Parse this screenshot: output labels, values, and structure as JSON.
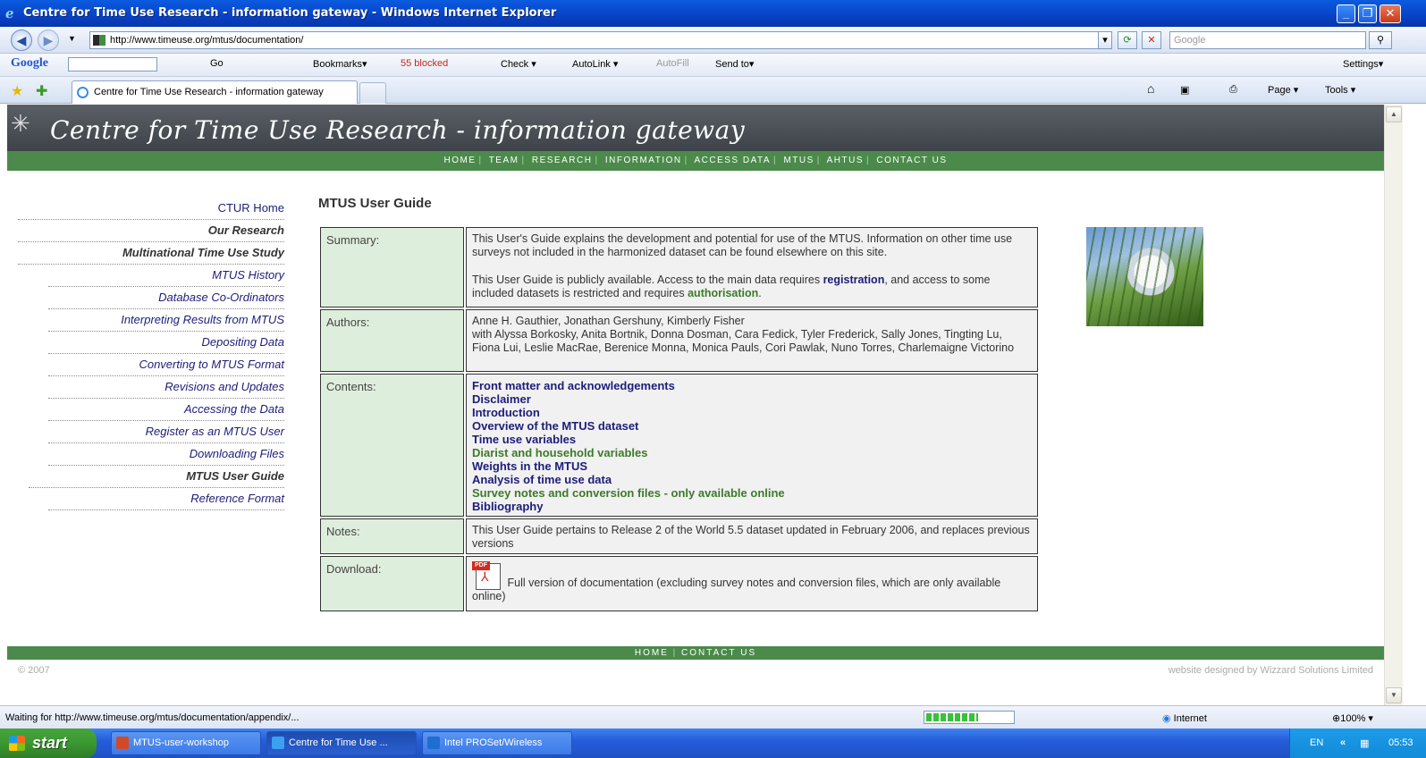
{
  "window": {
    "title": "Centre for Time Use Research - information gateway - Windows Internet Explorer",
    "buttons": [
      "_",
      "❐",
      "✕"
    ]
  },
  "address_bar": {
    "url": "http://www.timeuse.org/mtus/documentation/",
    "search_placeholder": "Google"
  },
  "google_toolbar": {
    "logo": "Google",
    "go": "Go",
    "bookmarks": "Bookmarks▾",
    "blocked": "55 blocked",
    "check": "Check ▾",
    "autolink": "AutoLink ▾",
    "autofill": "AutoFill",
    "sendto": "Send to▾",
    "settings": "Settings▾"
  },
  "tabs": {
    "active_tab": "Centre for Time Use Research - information gateway",
    "commands": {
      "page": "Page ▾",
      "tools": "Tools ▾"
    }
  },
  "site": {
    "title": "Centre for Time Use Research - information gateway",
    "nav": [
      "HOME",
      "TEAM",
      "RESEARCH",
      "INFORMATION",
      "ACCESS DATA",
      "MTUS",
      "AHTUS",
      "CONTACT US"
    ],
    "footer_nav": [
      "HOME",
      "CONTACT US"
    ],
    "copyright": "© 2007",
    "credit": "website designed by Wizzard Solutions Limited"
  },
  "left_nav": [
    {
      "label": "CTUR Home",
      "style": "plain"
    },
    {
      "label": "Our Research",
      "style": "bold"
    },
    {
      "label": "Multinational Time Use Study",
      "style": "bold"
    },
    {
      "label": "MTUS History",
      "style": "it"
    },
    {
      "label": "Database Co-Ordinators",
      "style": "it"
    },
    {
      "label": "Interpreting Results from MTUS",
      "style": "it"
    },
    {
      "label": "Depositing Data",
      "style": "it"
    },
    {
      "label": "Converting to MTUS Format",
      "style": "it"
    },
    {
      "label": "Revisions and Updates",
      "style": "it"
    },
    {
      "label": "Accessing the Data",
      "style": "it"
    },
    {
      "label": "Register as an MTUS User",
      "style": "it"
    },
    {
      "label": "Downloading Files",
      "style": "it"
    },
    {
      "label": "MTUS User Guide",
      "style": "bold"
    },
    {
      "label": "Reference Format",
      "style": "it"
    }
  ],
  "main": {
    "page_title": "MTUS User Guide",
    "summary_label": "Summary:",
    "summary_p1": "This User's Guide explains the development and potential for use of the MTUS. Information on other time use surveys not included in the harmonized dataset can be found elsewhere on this site.",
    "summary_p2_a": "This User Guide is publicly available. Access to the main data requires ",
    "summary_p2_link1": "registration",
    "summary_p2_b": ", and access to some included datasets is restricted and requires ",
    "summary_p2_link2": "authorisation",
    "summary_p2_c": ".",
    "authors_label": "Authors:",
    "authors_line1": "Anne H. Gauthier, Jonathan Gershuny, Kimberly Fisher",
    "authors_line2": "with Alyssa Borkosky, Anita Bortnik, Donna Dosman, Cara Fedick, Tyler Frederick, Sally Jones, Tingting Lu, Fiona Lui, Leslie MacRae, Berenice Monna, Monica Pauls, Cori Pawlak, Nuno Torres, Charlemaigne Victorino",
    "contents_label": "Contents:",
    "contents": [
      {
        "label": "Front matter and acknowledgements",
        "color": "blue"
      },
      {
        "label": "Disclaimer",
        "color": "blue"
      },
      {
        "label": "Introduction",
        "color": "blue"
      },
      {
        "label": "Overview of the MTUS dataset",
        "color": "blue"
      },
      {
        "label": "Time use variables",
        "color": "blue"
      },
      {
        "label": "Diarist and household variables",
        "color": "green"
      },
      {
        "label": "Weights in the MTUS",
        "color": "blue"
      },
      {
        "label": "Analysis of time use data",
        "color": "blue"
      },
      {
        "label": "Survey notes and conversion files - only available online",
        "color": "green"
      },
      {
        "label": "Bibliography",
        "color": "blue"
      }
    ],
    "notes_label": "Notes:",
    "notes_text": "This User Guide pertains to Release 2 of the World 5.5 dataset updated in February 2006, and replaces previous versions",
    "download_label": "Download:",
    "download_icon_label": "PDF",
    "download_text": "Full version of documentation (excluding survey notes and conversion files, which are only available online)"
  },
  "status_bar": {
    "message": "Waiting for http://www.timeuse.org/mtus/documentation/appendix/...",
    "progress": 0.6,
    "zone": "Internet",
    "zoom": "100%  ▾"
  },
  "taskbar": {
    "start": "start",
    "tasks": [
      {
        "label": "MTUS-user-workshop",
        "icon_color": "#d04a2a"
      },
      {
        "label": "Centre for Time Use ...",
        "icon_color": "#3aa0f0"
      },
      {
        "label": "Intel PROSet/Wireless",
        "icon_color": "#1e6ed0"
      }
    ],
    "lang": "EN",
    "clock": "05:53"
  }
}
